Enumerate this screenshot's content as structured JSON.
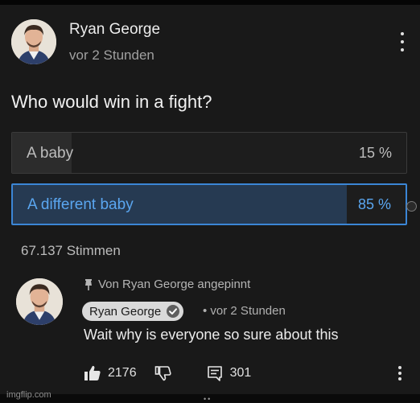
{
  "post": {
    "author": "Ryan George",
    "time": "vor 2 Stunden",
    "question": "Who would win in a fight?"
  },
  "poll": {
    "options": [
      {
        "label": "A baby",
        "percent_text": "15 %",
        "percent": 15,
        "selected": false
      },
      {
        "label": "A different baby",
        "percent_text": "85 %",
        "percent": 85,
        "selected": true
      }
    ],
    "votes": "67.137 Stimmen"
  },
  "comment": {
    "pinned_text": "Von Ryan George angepinnt",
    "author": "Ryan George",
    "time": "• vor 2 Stunden",
    "text": "Wait why is everyone so sure about this",
    "likes": "2176",
    "replies": "301"
  },
  "watermark": "imgflip.com",
  "scroll_indicator": "••",
  "colors": {
    "accent": "#3b86d6",
    "accent_text": "#5aa6f0",
    "background": "#191919"
  },
  "icons": [
    "kebab-menu-icon",
    "pin-icon",
    "verified-check-icon",
    "thumbs-up-icon",
    "thumbs-down-icon",
    "reply-icon"
  ]
}
